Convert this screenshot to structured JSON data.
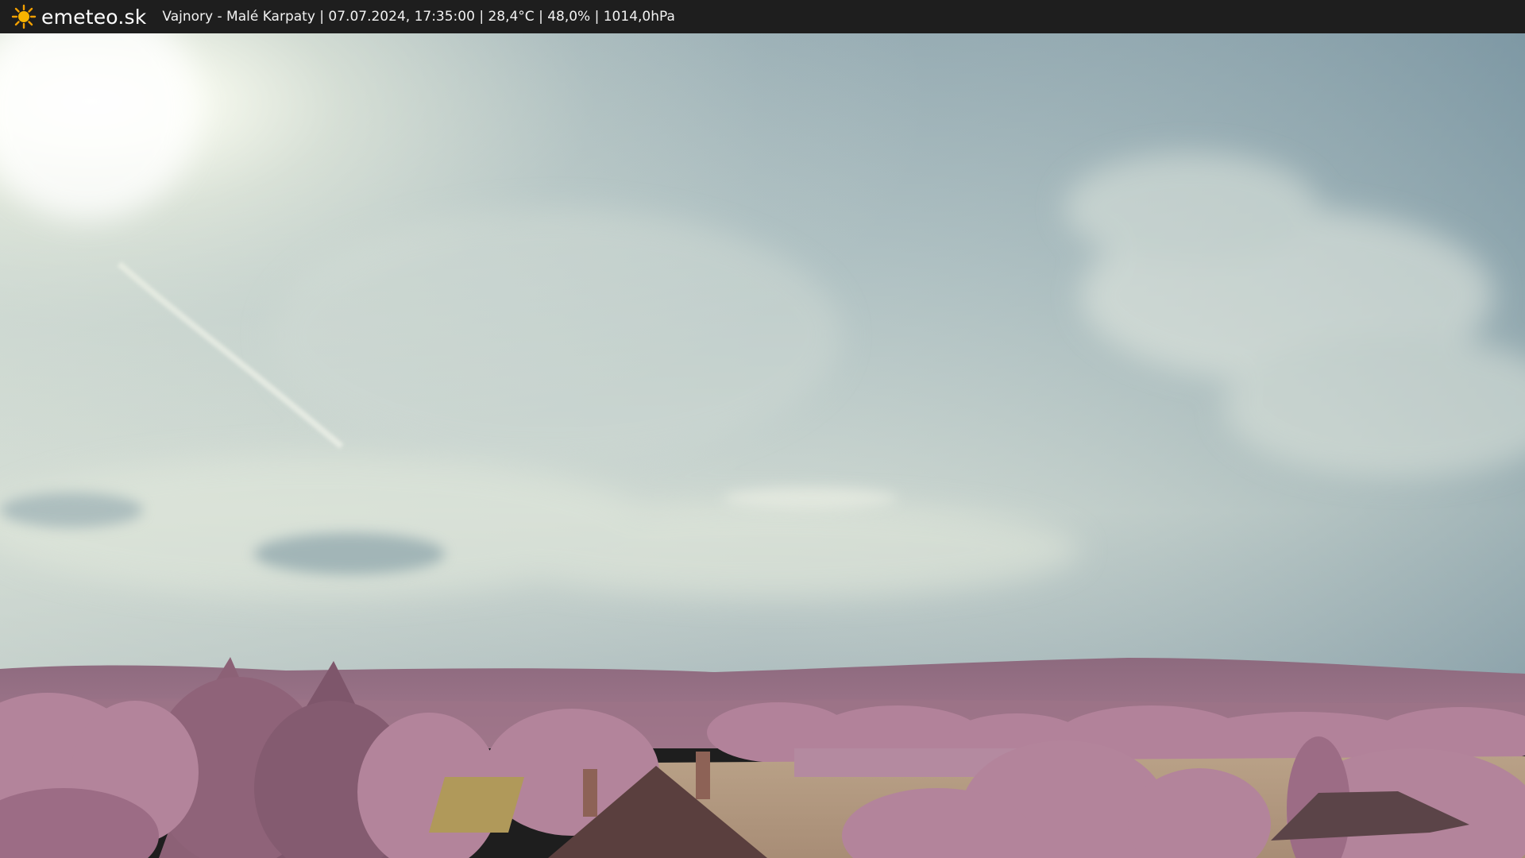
{
  "header": {
    "logo_icon": "sun-icon",
    "site_name": "emeteo.sk",
    "location": "Vajnory - Malé Karpaty",
    "timestamp": "07.07.2024, 17:35:00",
    "temperature": "28,4°C",
    "humidity": "48,0%",
    "pressure": "1014,0hPa",
    "caption": "Vajnory - Malé Karpaty | 07.07.2024, 17:35:00 | 28,4°C | 48,0% | 1014,0hPa"
  },
  "colors": {
    "bar": "#1e1e1e",
    "sun": "#f4a000",
    "sky_top": "#7e98a4",
    "sky_haze": "#dfe6de",
    "hills": "#9a6f86",
    "foliage": "#b07f98",
    "field": "#b79c83"
  }
}
